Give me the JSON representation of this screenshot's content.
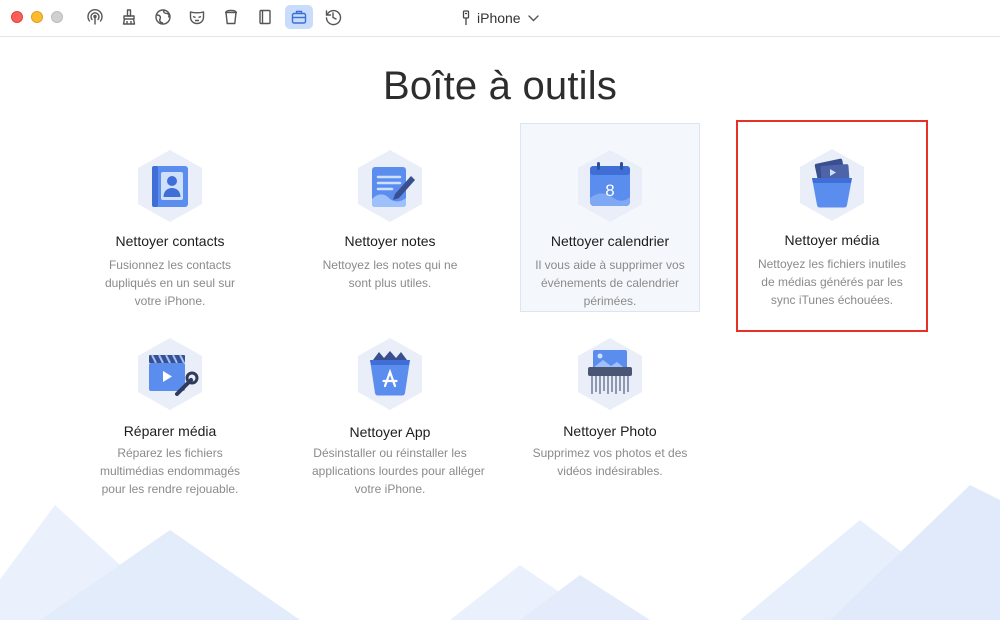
{
  "device": {
    "name": "iPhone"
  },
  "toolbar": {
    "buttons": [
      {
        "icon": "airbackup-icon"
      },
      {
        "icon": "brush-clean-icon"
      },
      {
        "icon": "globe-icon"
      },
      {
        "icon": "mask-privacy-icon"
      },
      {
        "icon": "trash-bin-icon"
      },
      {
        "icon": "book-icon"
      },
      {
        "icon": "toolbox-icon",
        "active": true
      },
      {
        "icon": "history-icon"
      }
    ]
  },
  "page": {
    "title": "Boîte à outils"
  },
  "tools": [
    {
      "name": "Nettoyer contacts",
      "desc": [
        "Fusionnez les contacts",
        "dupliqués en un seul sur",
        "votre iPhone."
      ],
      "icon": "contacts-icon"
    },
    {
      "name": "Nettoyer notes",
      "desc": [
        "Nettoyez les notes qui ne",
        "sont plus utiles."
      ],
      "icon": "notes-icon"
    },
    {
      "name": "Nettoyer calendrier",
      "desc": [
        "Il vous aide à supprimer vos",
        "événements de calendrier",
        "périmées."
      ],
      "icon": "calendar-icon",
      "calendar_day": "8"
    },
    {
      "name": "Nettoyer média",
      "desc": [
        "Nettoyez les fichiers inutiles",
        "de médias générés par les",
        "sync iTunes échouées."
      ],
      "icon": "media-bucket-icon"
    },
    {
      "name": "Réparer média",
      "desc": [
        "Réparez les fichiers",
        "multimédias endommagés",
        "pour les rendre rejouable."
      ],
      "icon": "repair-media-icon"
    },
    {
      "name": "Nettoyer App",
      "desc": [
        "Désinstaller ou réinstaller les",
        "applications lourdes pour alléger",
        "votre iPhone."
      ],
      "icon": "app-bucket-icon"
    },
    {
      "name": "Nettoyer Photo",
      "desc": [
        "Supprimez vos photos et des",
        "vidéos indésirables."
      ],
      "icon": "photo-shredder-icon"
    }
  ],
  "colors": {
    "accent": "#5b8def",
    "highlight_border": "#e53224",
    "hexagon": "#e9eef8"
  }
}
